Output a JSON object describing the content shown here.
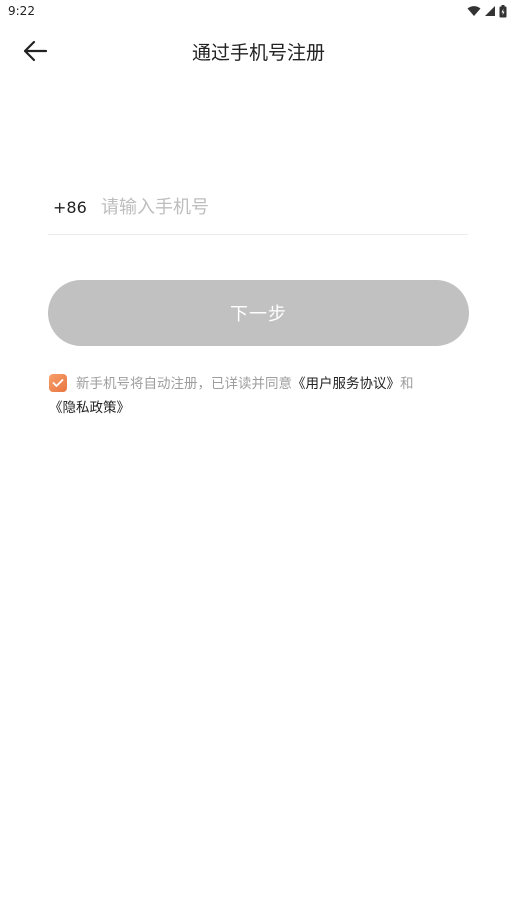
{
  "status_bar": {
    "time": "9:22",
    "icons": [
      "wifi-icon",
      "signal-icon",
      "battery-icon"
    ]
  },
  "header": {
    "title": "通过手机号注册",
    "back_icon": "arrow-left-icon"
  },
  "phone": {
    "country_code": "+86",
    "value": "",
    "placeholder": "请输入手机号"
  },
  "next_button": {
    "label": "下一步",
    "color": "#c1c1c1"
  },
  "agreement": {
    "checked": true,
    "checkbox_color": "#ee8350",
    "prefix": "新手机号将自动注册，已详读并同意",
    "link_terms": "《用户服务协议》",
    "conjunction": "和",
    "link_privacy": "《隐私政策》"
  }
}
